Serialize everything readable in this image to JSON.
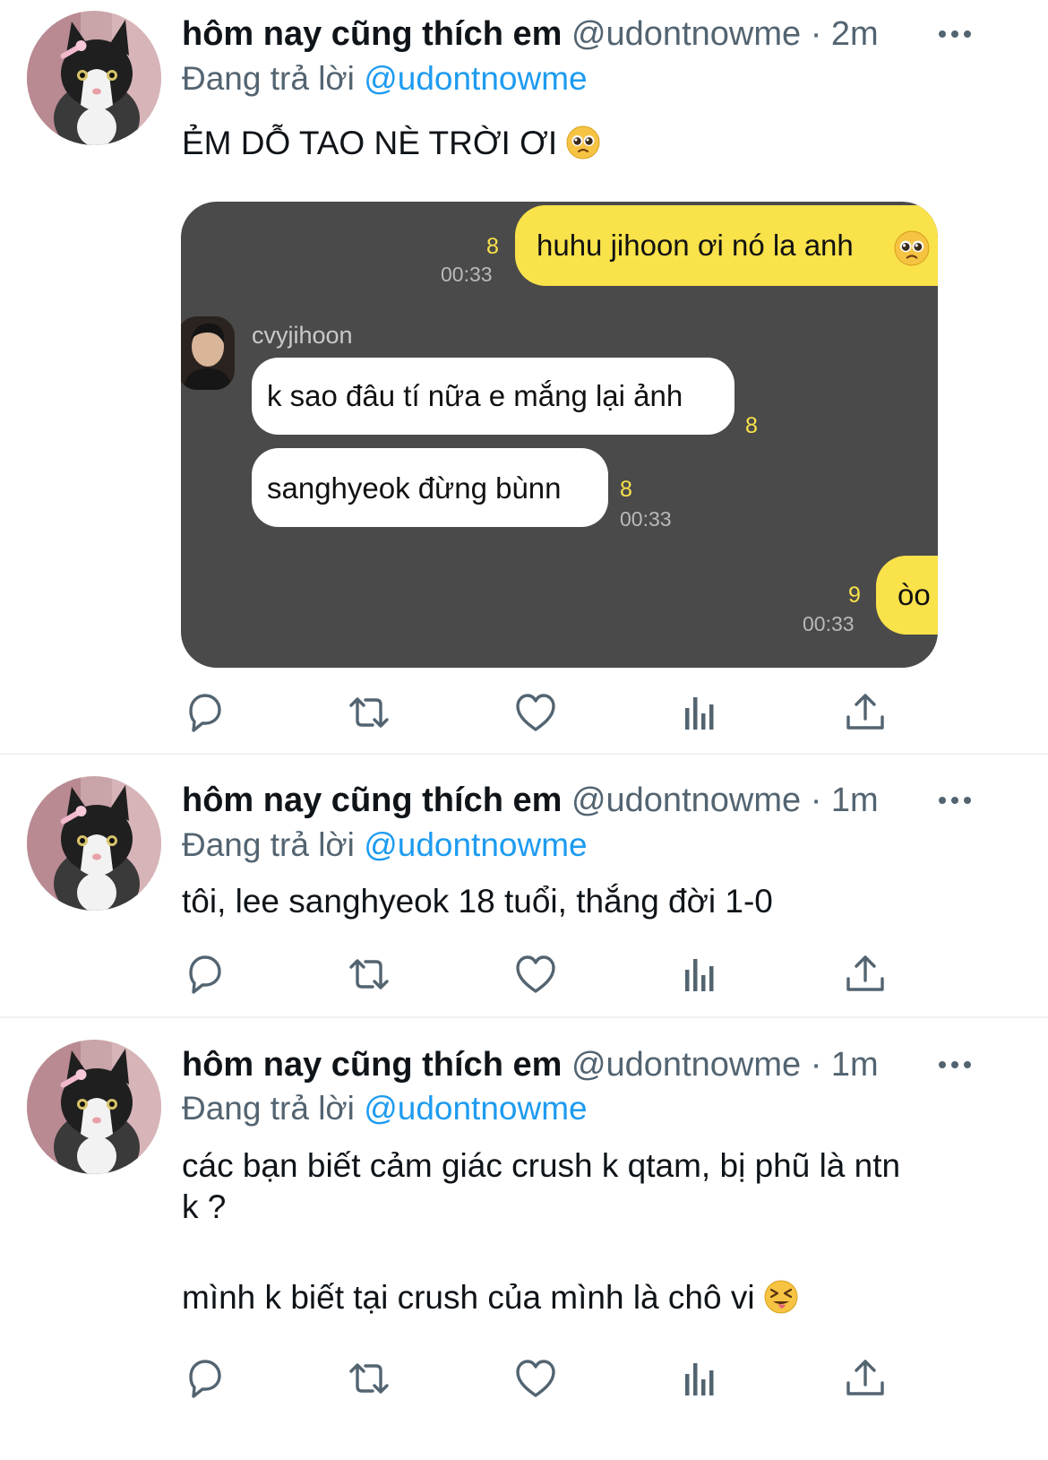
{
  "tweets": [
    {
      "name": "hôm nay cũng thích em",
      "handle": "@udontnowme",
      "separator": "·",
      "time": "2m",
      "reply_prefix": "Đang trả lời",
      "reply_to": "@udontnowme",
      "text_lines": [
        "ẺM DỖ TAO NÈ TRỜI ƠI"
      ],
      "trailing_emoji": "pleading-face"
    },
    {
      "name": "hôm nay cũng thích em",
      "handle": "@udontnowme",
      "separator": "·",
      "time": "1m",
      "reply_prefix": "Đang trả lời",
      "reply_to": "@udontnowme",
      "text_lines": [
        "tôi, lee sanghyeok 18 tuổi, thắng đời 1-0"
      ]
    },
    {
      "name": "hôm nay cũng thích em",
      "handle": "@udontnowme",
      "separator": "·",
      "time": "1m",
      "reply_prefix": "Đang trả lời",
      "reply_to": "@udontnowme",
      "text_lines": [
        "các bạn biết cảm giác crush k qtam, bị phũ là ntn",
        "k ?",
        "",
        "mình k biết tại crush của mình là chô vi"
      ],
      "trailing_emoji": "squinting-tongue-face"
    }
  ],
  "chat": {
    "messages": [
      {
        "from": "me",
        "text": "huhu jihoon ơi nó la anh",
        "count": "8",
        "time": "00:33",
        "emoji": "pleading-face"
      },
      {
        "from": "other",
        "sender": "cvyjihoon",
        "text": "k sao đâu tí nữa e mắng lại ảnh",
        "count": "8"
      },
      {
        "from": "other",
        "text": "sanghyeok đừng bùnn",
        "count": "8",
        "time": "00:33"
      },
      {
        "from": "me",
        "text": "òo",
        "count": "9",
        "time": "00:33"
      }
    ],
    "colors": {
      "background": "#4a4a4a",
      "my_bubble": "#f9e24a",
      "other_bubble": "#ffffff"
    }
  },
  "action_icons": [
    "reply-icon",
    "retweet-icon",
    "like-icon",
    "analytics-icon",
    "share-icon"
  ],
  "colors": {
    "link": "#1d9bf0",
    "secondary_text": "#536471",
    "divider": "#eff3f4",
    "icon": "#536471"
  }
}
